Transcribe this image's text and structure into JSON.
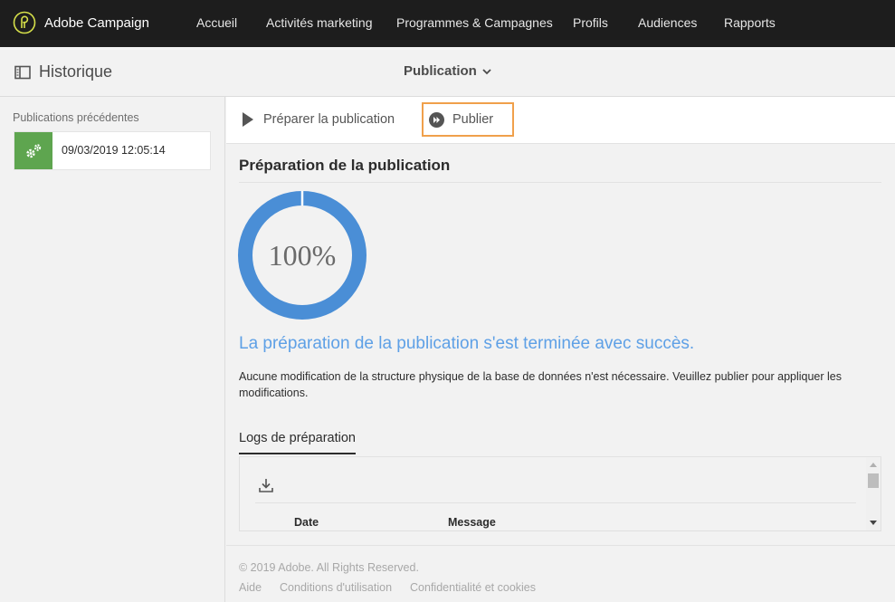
{
  "topbar": {
    "brand_name": "Adobe Campaign",
    "nav": [
      "Accueil",
      "Activités marketing",
      "Programmes & Campagnes",
      "Profils",
      "Audiences",
      "Rapports"
    ]
  },
  "subheader": {
    "history_label": "Historique",
    "publication_label": "Publication"
  },
  "sidebar": {
    "title": "Publications précédentes",
    "items": [
      {
        "date": "09/03/2019 12:05:14"
      }
    ]
  },
  "actions": {
    "prepare_label": "Préparer la publication",
    "publish_label": "Publier"
  },
  "main": {
    "section_title": "Préparation de la publication",
    "progress_text": "100%",
    "progress_value": 1.0,
    "success_message": "La préparation de la publication s'est terminée avec succès.",
    "info_message": "Aucune modification de la structure physique de la base de données n'est nécessaire. Veuillez publier pour appliquer les modifications.",
    "logs_tab": "Logs de préparation",
    "columns": [
      "Date",
      "Message"
    ]
  },
  "footer": {
    "copyright": "© 2019 Adobe. All Rights Reserved.",
    "links": [
      "Aide",
      "Conditions d'utilisation",
      "Confidentialité et cookies"
    ]
  },
  "colors": {
    "topbar": "#1d1d1d",
    "accent_blue": "#4a8ed6",
    "success_text": "#5ea0e6",
    "publish_border": "#f0a04b",
    "history_green": "#5ea54f"
  }
}
